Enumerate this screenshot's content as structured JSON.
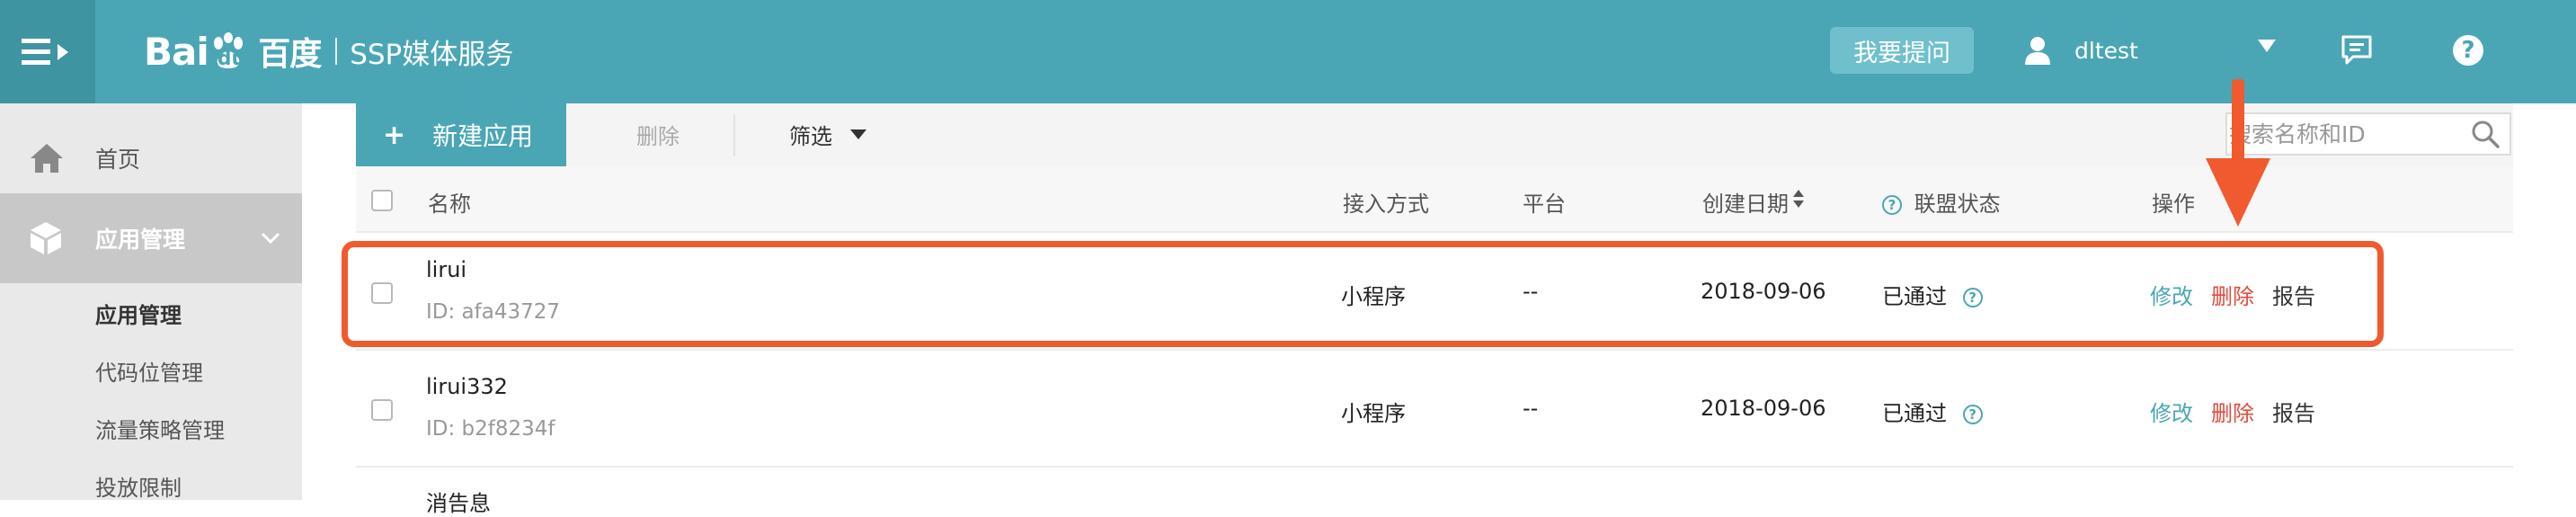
{
  "header": {
    "logo_bai": "Bai",
    "logo_du": "du",
    "logo_cn": "百度",
    "service_name": "SSP媒体服务",
    "ask_button": "我要提问",
    "username": "dltest"
  },
  "sidebar": {
    "home": "首页",
    "app_management": "应用管理",
    "sub_items": [
      "应用管理",
      "代码位管理",
      "流量策略管理",
      "投放限制"
    ]
  },
  "toolbar": {
    "new_app": "新建应用",
    "delete": "删除",
    "filter": "筛选",
    "search_placeholder": "搜索名称和ID"
  },
  "table": {
    "columns": [
      "名称",
      "接入方式",
      "平台",
      "创建日期",
      "联盟状态",
      "操作"
    ],
    "rows": [
      {
        "name": "lirui",
        "id": "ID: afa43727",
        "access": "小程序",
        "platform": "--",
        "date": "2018-09-06",
        "status": "已通过",
        "actions": [
          "修改",
          "删除",
          "报告"
        ]
      },
      {
        "name": "lirui332",
        "id": "ID: b2f8234f",
        "access": "小程序",
        "platform": "--",
        "date": "2018-09-06",
        "status": "已通过",
        "actions": [
          "修改",
          "删除",
          "报告"
        ]
      }
    ],
    "partial_row_name": "消告息"
  },
  "colors": {
    "brand": "#4aa6b5",
    "highlight": "#f05a2e",
    "delete": "#e24b3b"
  },
  "icons": [
    "menu-toggle-icon",
    "baidu-paw-icon",
    "user-icon",
    "chevron-down-icon",
    "chat-icon",
    "help-icon",
    "home-icon",
    "cube-icon",
    "plus-icon",
    "search-icon",
    "sort-icon",
    "question-icon",
    "arrow-annotation"
  ]
}
